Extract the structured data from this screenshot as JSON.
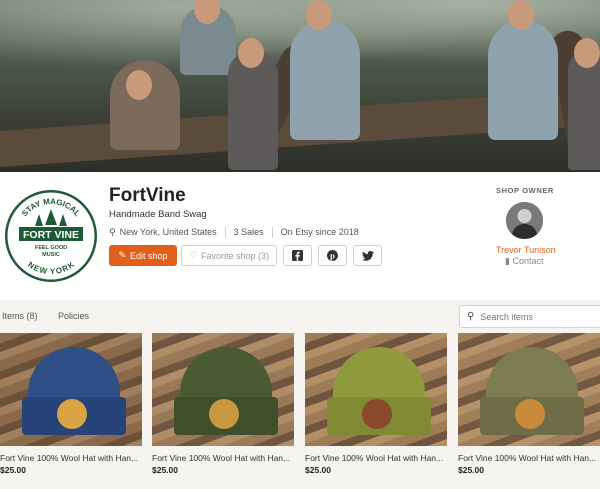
{
  "shop": {
    "name": "FortVine",
    "tagline": "Handmade Band Swag",
    "location": "New York, United States",
    "sales": "3 Sales",
    "since": "On Etsy since 2018",
    "logo_text": {
      "top": "STAY MAGICAL",
      "middle": "FORT VINE",
      "sub1": "FEEL GOOD",
      "sub2": "MUSIC",
      "bottom": "NEW YORK"
    }
  },
  "actions": {
    "edit": "Edit shop",
    "favorite": "Favorite shop (3)"
  },
  "owner": {
    "label": "SHOP OWNER",
    "name": "Trevor Tunison",
    "contact": "Contact"
  },
  "tabs": {
    "items": "Items (8)",
    "policies": "Policies"
  },
  "search": {
    "placeholder": "Search items"
  },
  "items": [
    {
      "title": "Fort Vine 100% Wool Hat with Han...",
      "price": "$25.00",
      "color": "#2f4f86"
    },
    {
      "title": "Fort Vine 100% Wool Hat with Han...",
      "price": "$25.00",
      "color": "#4a5b34"
    },
    {
      "title": "Fort Vine 100% Wool Hat with Han...",
      "price": "$25.00",
      "color": "#8f9a3c"
    },
    {
      "title": "Fort Vine 100% Wool Hat with Han...",
      "price": "$25.00",
      "color": "#7d7c52"
    }
  ],
  "colors": {
    "accent": "#e05f1a",
    "logo_green": "#1f5a35"
  }
}
